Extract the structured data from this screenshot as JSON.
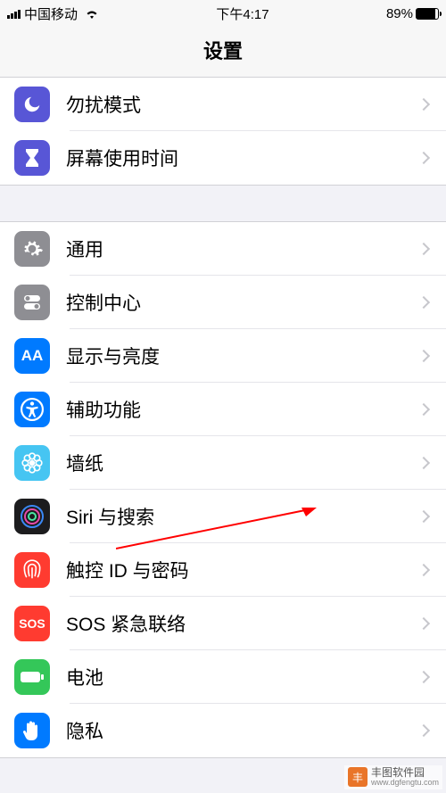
{
  "status": {
    "carrier": "中国移动",
    "time": "下午4:17",
    "battery_pct": "89%"
  },
  "header": {
    "title": "设置"
  },
  "colors": {
    "purple": "#5856d6",
    "gray": "#8e8e93",
    "blue": "#007aff",
    "green": "#34c759",
    "red": "#ff3b30",
    "siri": "#1c1c1e"
  },
  "group1": [
    {
      "key": "dnd",
      "label": "勿扰模式"
    },
    {
      "key": "screentime",
      "label": "屏幕使用时间"
    }
  ],
  "group2": [
    {
      "key": "general",
      "label": "通用"
    },
    {
      "key": "control",
      "label": "控制中心"
    },
    {
      "key": "display",
      "label": "显示与亮度"
    },
    {
      "key": "accessibility",
      "label": "辅助功能"
    },
    {
      "key": "wallpaper",
      "label": "墙纸"
    },
    {
      "key": "siri",
      "label": "Siri 与搜索"
    },
    {
      "key": "touchid",
      "label": "触控 ID 与密码"
    },
    {
      "key": "sos",
      "label": "SOS 紧急联络",
      "icon_text": "SOS"
    },
    {
      "key": "battery",
      "label": "电池"
    },
    {
      "key": "privacy",
      "label": "隐私"
    }
  ],
  "watermark": {
    "name": "丰图软件园",
    "url": "www.dgfengtu.com",
    "logo": "丰"
  }
}
